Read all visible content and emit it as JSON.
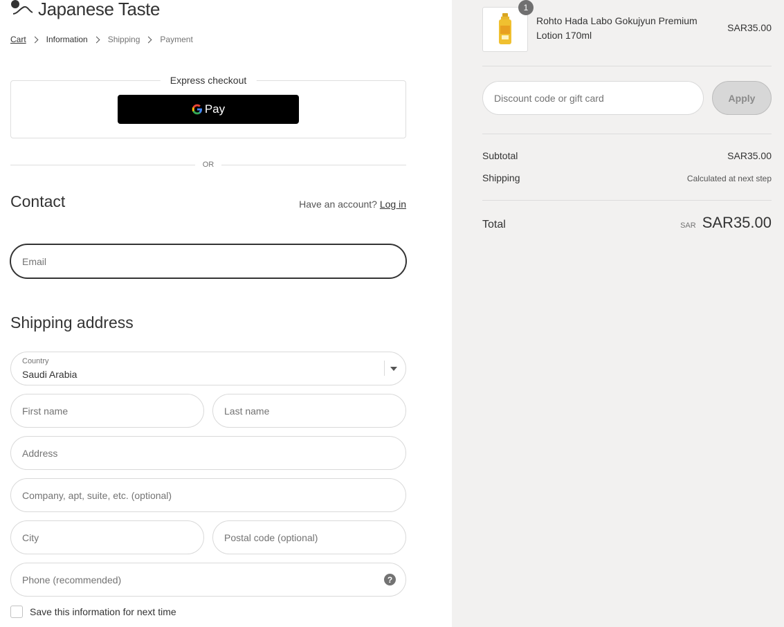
{
  "brand": {
    "name": "Japanese Taste"
  },
  "breadcrumb": [
    {
      "label": "Cart"
    },
    {
      "label": "Information"
    },
    {
      "label": "Shipping"
    },
    {
      "label": "Payment"
    }
  ],
  "express": {
    "title": "Express checkout",
    "gpay_label": "Pay"
  },
  "divider": {
    "or_label": "OR"
  },
  "contact": {
    "heading": "Contact",
    "account_prompt": "Have an account?",
    "login_label": "Log in",
    "email_placeholder": "Email"
  },
  "shipping_address": {
    "heading": "Shipping address",
    "country_label": "Country",
    "country_value": "Saudi Arabia",
    "first_name_placeholder": "First name",
    "last_name_placeholder": "Last name",
    "address_placeholder": "Address",
    "company_placeholder": "Company, apt, suite, etc. (optional)",
    "city_placeholder": "City",
    "postal_placeholder": "Postal code (optional)",
    "phone_placeholder": "Phone (recommended)",
    "help_glyph": "?",
    "save_info_label": "Save this information for next time"
  },
  "order": {
    "product": {
      "quantity": "1",
      "name": "Rohto Hada Labo Gokujyun Premium Lotion 170ml",
      "price": "SAR35.00"
    },
    "discount_placeholder": "Discount code or gift card",
    "apply_label": "Apply",
    "subtotal_label": "Subtotal",
    "subtotal_value": "SAR35.00",
    "shipping_label": "Shipping",
    "shipping_value": "Calculated at next step",
    "total_label": "Total",
    "total_currency": "SAR",
    "total_value": "SAR35.00"
  },
  "colors": {
    "accent": "#333333",
    "sidebar_bg": "#f2f1f0",
    "gpay_bg": "#000000",
    "apply_bg": "#d7d7d7"
  }
}
